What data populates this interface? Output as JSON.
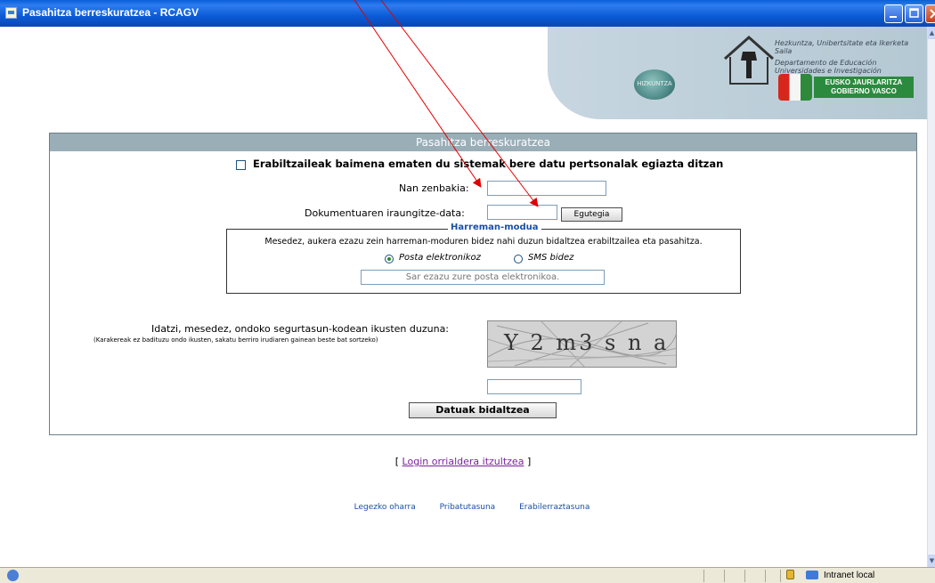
{
  "window": {
    "title": "Pasahitza berreskuratzea - RCAGV",
    "min_icon": "minimize-icon",
    "max_icon": "maximize-icon",
    "close_icon": "close-icon"
  },
  "banner": {
    "dept_eu": "Hezkuntza, Unibertsitate eta Ikerketa Saila",
    "dept_es": "Departamento de Educación Universidades e Investigación",
    "hizkuntza": "HIZKUNTZA",
    "gov_logo_line1": "EUSKO JAURLARITZA",
    "gov_logo_line2": "GOBIERNO VASCO"
  },
  "form": {
    "header": "Pasahitza berreskuratzea",
    "consent_label": "Erabiltzaileak baimena ematen du sistemak bere datu pertsonalak egiazta ditzan",
    "consent_checked": false,
    "id_label": "Nan zenbakia:",
    "id_value": "",
    "expiry_label": "Dokumentuaren iraungitze-data:",
    "expiry_value": "",
    "calendar_button": "Egutegia",
    "contact": {
      "legend": "Harreman-modua",
      "hint": "Mesedez, aukera ezazu zein harreman-moduren bidez nahi duzun bidaltzea erabiltzailea eta pasahitza.",
      "option_email": "Posta elektronikoz",
      "option_sms": "SMS bidez",
      "selected": "Posta elektronikoz",
      "email_placeholder": "Sar ezazu zure posta elektronikoa."
    },
    "captcha_label": "Idatzi, mesedez, ondoko segurtasun-kodean ikusten duzuna:",
    "captcha_hint": "(Karakereak ez badituzu ondo ikusten, sakatu berriro irudiaren gainean beste bat sortzeko)",
    "captcha_text": "Y 2 m3 s n a",
    "captcha_value": "",
    "submit_button": "Datuak bidaltzea"
  },
  "links": {
    "back_prefix": "[",
    "back_link": "Login orrialdera itzultzea",
    "back_suffix": "]",
    "footer": [
      "Legezko oharra",
      "Pribatutasuna",
      "Erabilerraztasuna"
    ]
  },
  "statusbar": {
    "zone": "Intranet local"
  },
  "colors": {
    "titlebar": "#0a5ed8",
    "panel_header": "#9aaeb8",
    "link": "#1a4fa8",
    "visited_link": "#7a1fa2",
    "annotation_arrow": "#e00000"
  }
}
